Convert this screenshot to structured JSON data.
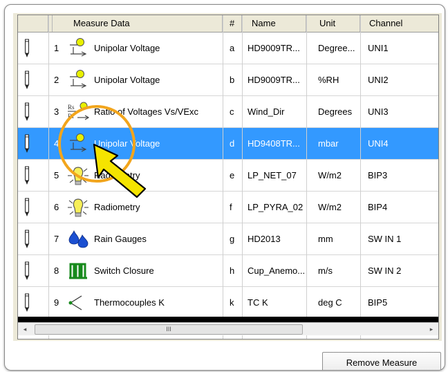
{
  "header": {
    "measure_data": "Measure Data",
    "index": "#",
    "name": "Name",
    "unit": "Unit",
    "channel": "Channel"
  },
  "rows": [
    {
      "num": "1",
      "type": "Unipolar Voltage",
      "id": "a",
      "name": "HD9009TR...",
      "unit": "Degree...",
      "channel": "UNI1",
      "icon": "unipolar-voltage-icon"
    },
    {
      "num": "2",
      "type": "Unipolar Voltage",
      "id": "b",
      "name": "HD9009TR...",
      "unit": "%RH",
      "channel": "UNI2",
      "icon": "unipolar-voltage-icon"
    },
    {
      "num": "3",
      "type": "Ratio of Voltages Vs/VExc",
      "id": "c",
      "name": "Wind_Dir",
      "unit": "Degrees",
      "channel": "UNI3",
      "icon": "ratio-voltage-icon"
    },
    {
      "num": "4",
      "type": "Unipolar Voltage",
      "id": "d",
      "name": "HD9408TR...",
      "unit": "mbar",
      "channel": "UNI4",
      "icon": "unipolar-voltage-icon",
      "selected": true
    },
    {
      "num": "5",
      "type": "Radiometry",
      "id": "e",
      "name": "LP_NET_07",
      "unit": "W/m2",
      "channel": "BIP3",
      "icon": "lightbulb-icon"
    },
    {
      "num": "6",
      "type": "Radiometry",
      "id": "f",
      "name": "LP_PYRA_02",
      "unit": "W/m2",
      "channel": "BIP4",
      "icon": "lightbulb-icon"
    },
    {
      "num": "7",
      "type": "Rain Gauges",
      "id": "g",
      "name": "HD2013",
      "unit": "mm",
      "channel": "SW IN 1",
      "icon": "rain-drops-icon"
    },
    {
      "num": "8",
      "type": "Switch Closure",
      "id": "h",
      "name": "Cup_Anemo...",
      "unit": "m/s",
      "channel": "SW IN 2",
      "icon": "switch-closure-icon"
    },
    {
      "num": "9",
      "type": "Thermocouples  K",
      "id": "k",
      "name": "TC K",
      "unit": "deg C",
      "channel": "BIP5",
      "icon": "thermocouple-icon"
    }
  ],
  "scrollbar": {
    "left_arrow": "◂",
    "right_arrow": "▸",
    "thumb_grip": "III"
  },
  "buttons": {
    "remove_measure": "Remove Measure"
  },
  "colors": {
    "selection": "#3399ff",
    "callout": "#f2a51c",
    "cursor": "#f5e400"
  }
}
